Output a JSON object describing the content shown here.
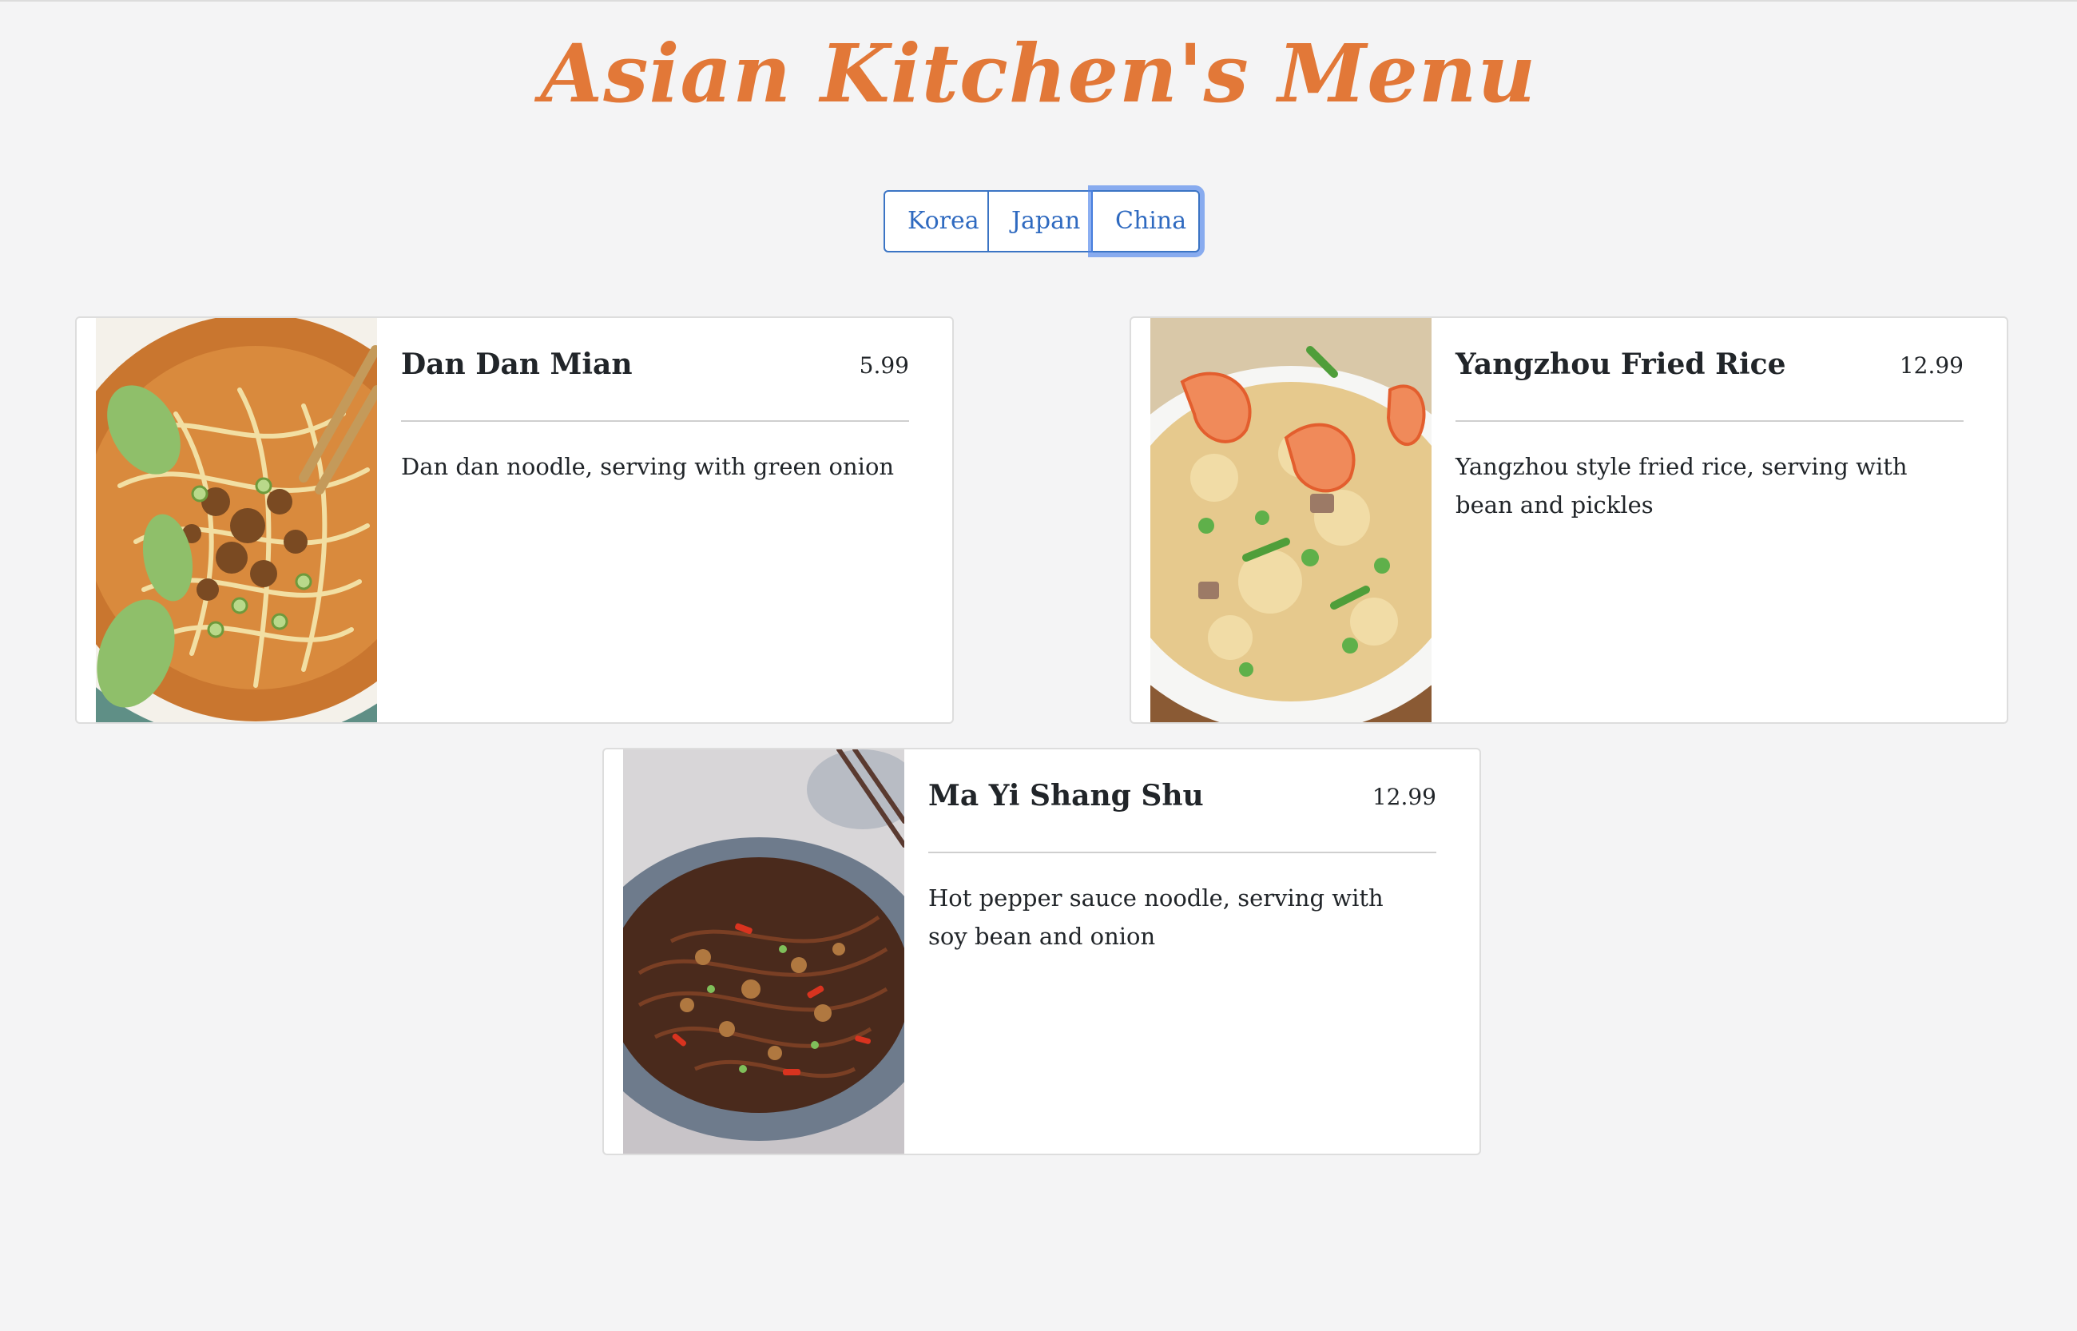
{
  "header": {
    "title": "Asian Kitchen's Menu"
  },
  "filters": [
    {
      "label": "Korea"
    },
    {
      "label": "Japan"
    },
    {
      "label": "China",
      "active": true
    }
  ],
  "items": [
    {
      "name": "Dan Dan Mian",
      "price": "5.99",
      "description": "Dan dan noodle, serving with green onion"
    },
    {
      "name": "Yangzhou Fried Rice",
      "price": "12.99",
      "description": "Yangzhou style fried rice, serving with bean and pickles"
    },
    {
      "name": "Ma Yi Shang Shu",
      "price": "12.99",
      "description": "Hot pepper sauce noodle, serving with soy bean and onion"
    }
  ],
  "colors": {
    "title": "#e27838",
    "button": "#2f6ac0",
    "focus_ring": "#4f84eb",
    "background": "#f4f4f5"
  }
}
